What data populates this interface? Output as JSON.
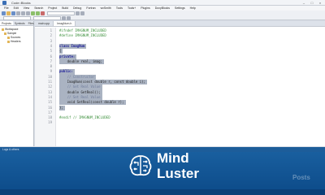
{
  "window": {
    "title": "Code::Blocks"
  },
  "menu": [
    "File",
    "Edit",
    "View",
    "Search",
    "Project",
    "Build",
    "Debug",
    "Fortran",
    "wxSmith",
    "Tools",
    "Tools+",
    "Plugins",
    "DoxyBlocks",
    "Settings",
    "Help"
  ],
  "panel": {
    "tabs": [
      "Projects",
      "Symbols",
      "Files"
    ],
    "tree": [
      "Workspace",
      "Sample",
      "Sources",
      "Headers"
    ]
  },
  "editor": {
    "tabs": [
      "main.cpp",
      "ImagNum.h"
    ],
    "lines": [
      {
        "n": "1",
        "text": "#ifndef IMAGNUM_INCLUDED",
        "kind": "pre",
        "sel": false
      },
      {
        "n": "2",
        "text": "#define IMAGNUM_INCLUDED",
        "kind": "pre",
        "sel": false
      },
      {
        "n": "3",
        "text": "",
        "kind": "txt",
        "sel": false
      },
      {
        "n": "4",
        "text": "class ImagNum",
        "kind": "kw",
        "sel": true
      },
      {
        "n": "5",
        "text": "{",
        "kind": "txt",
        "sel": true
      },
      {
        "n": "6",
        "text": "private:",
        "kind": "kw",
        "sel": true
      },
      {
        "n": "7",
        "text": "    double real, imag;",
        "kind": "txt",
        "sel": true
      },
      {
        "n": "8",
        "text": "",
        "kind": "txt",
        "sel": false
      },
      {
        "n": "9",
        "text": "public:",
        "kind": "kw",
        "sel": true
      },
      {
        "n": "10",
        "text": "    // Constructor",
        "kind": "cmt",
        "sel": true
      },
      {
        "n": "11",
        "text": "    ImagNum(const double r, const double i);",
        "kind": "txt",
        "sel": true
      },
      {
        "n": "12",
        "text": "    // Get Real Value",
        "kind": "cmt",
        "sel": true
      },
      {
        "n": "13",
        "text": "    double GetReal();",
        "kind": "txt",
        "sel": true
      },
      {
        "n": "14",
        "text": "    // Set Real Value",
        "kind": "cmt",
        "sel": true
      },
      {
        "n": "15",
        "text": "    void SetReal(const double r);",
        "kind": "txt",
        "sel": true
      },
      {
        "n": "16",
        "text": "};",
        "kind": "txt",
        "sel": true
      },
      {
        "n": "17",
        "text": "",
        "kind": "txt",
        "sel": false
      },
      {
        "n": "18",
        "text": "#endif // IMAGNUM_INCLUDED",
        "kind": "pre",
        "sel": false
      },
      {
        "n": "19",
        "text": "",
        "kind": "txt",
        "sel": false
      }
    ]
  },
  "logs": {
    "tabs": [
      "Logs & others"
    ]
  },
  "brand": {
    "line1": "Mind",
    "line2": "Luster",
    "logo_icon": "brain-icon",
    "color": "#ffffff"
  },
  "watermark": "Posts"
}
